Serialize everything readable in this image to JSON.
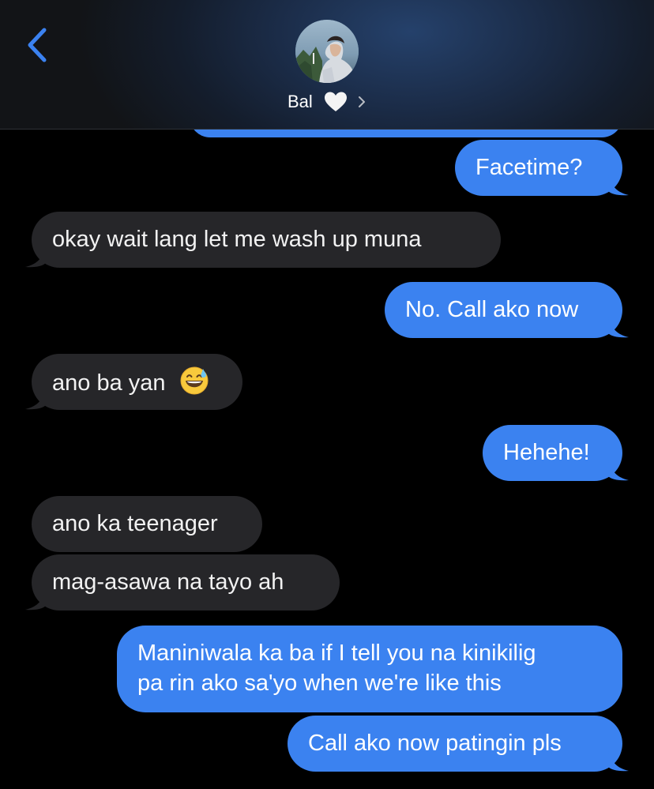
{
  "header": {
    "contact_name": "Bal",
    "heart_icon": "white-heart-icon",
    "back_icon": "chevron-left-icon",
    "accent_color": "#3b82f0"
  },
  "messages": [
    {
      "side": "sent",
      "text": "Facetime?"
    },
    {
      "side": "received",
      "text": "okay wait lang let me wash up muna"
    },
    {
      "side": "sent",
      "text": "No. Call ako now"
    },
    {
      "side": "received",
      "text": "ano ba yan",
      "emoji": "grinning-face-with-sweat"
    },
    {
      "side": "sent",
      "text": "Hehehe!"
    },
    {
      "side": "received",
      "text": "ano ka teenager"
    },
    {
      "side": "received",
      "text": "mag-asawa na tayo ah"
    },
    {
      "side": "sent",
      "lines": [
        "Maniniwala ka ba if I tell you na kinikilig",
        "pa rin ako sa'yo when we're like this"
      ]
    },
    {
      "side": "sent",
      "text": "Call ako now patingin pls"
    }
  ],
  "colors": {
    "sent_bubble": "#3b82f0",
    "received_bubble": "#262629",
    "background": "#000000"
  }
}
